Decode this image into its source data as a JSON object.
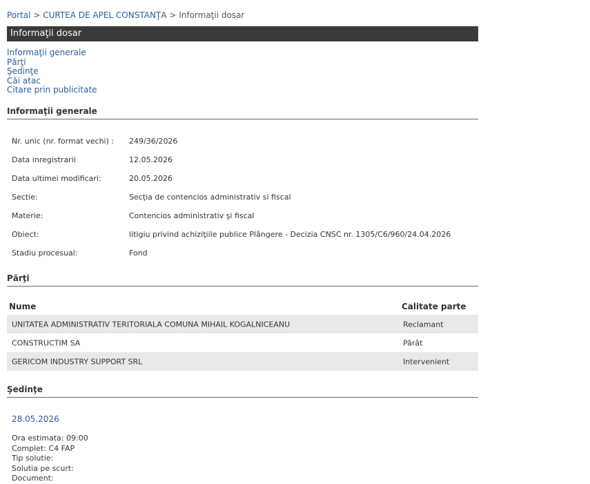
{
  "breadcrumb": {
    "items": [
      "Portal",
      "CURTEA DE APEL CONSTANŢA",
      "Informaţii dosar"
    ],
    "separator": ">"
  },
  "header": {
    "title": "Informaţii dosar"
  },
  "nav_links": [
    "Informaţii generale",
    "Părţi",
    "Şedinţe",
    "Căi atac",
    "Citare prin publicitate"
  ],
  "general_info": {
    "section_title": "Informaţii generale",
    "rows": [
      {
        "label": "Nr. unic (nr. format vechi) :",
        "value": "249/36/2026"
      },
      {
        "label": "Data inregistrarii",
        "value": "12.05.2026"
      },
      {
        "label": "Data ultimei modificari:",
        "value": "20.05.2026"
      },
      {
        "label": "Sectie:",
        "value": "Secţia de contencios administrativ si fiscal"
      },
      {
        "label": "Materie:",
        "value": "Contencios administrativ şi fiscal"
      },
      {
        "label": "Obiect:",
        "value": "litigiu privind achiziţiile publice Plângere - Decizia CNSC nr. 1305/C6/960/24.04.2026"
      },
      {
        "label": "Stadiu procesual:",
        "value": "Fond"
      }
    ]
  },
  "parties": {
    "section_title": "Părţi",
    "columns": [
      "Nume",
      "Calitate parte"
    ],
    "rows": [
      {
        "name": "UNITATEA ADMINISTRATIV TERITORIALA COMUNA MIHAIL KOGALNICEANU",
        "role": "Reclamant"
      },
      {
        "name": "CONSTRUCTIM SA",
        "role": "Pârât"
      },
      {
        "name": "GERICOM INDUSTRY SUPPORT SRL",
        "role": "Intervenient"
      }
    ]
  },
  "hearings": {
    "section_title": "Şedinţe",
    "date": "28.05.2026",
    "details": [
      "Ora estimata: 09:00",
      "Complet: C4 FAP",
      "Tip solutie:",
      "Solutia pe scurt:",
      "Document:"
    ]
  },
  "colors": {
    "link": "#2a5e9a",
    "titlebar_bg": "#3a3a3a",
    "row_shade": "#e9e9e9"
  }
}
